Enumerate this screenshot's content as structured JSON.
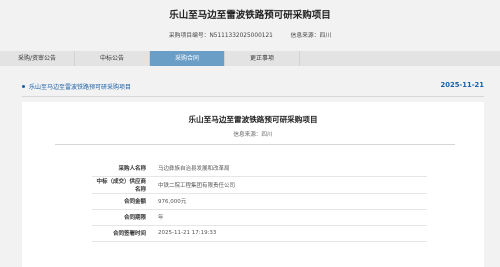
{
  "page": {
    "title": "乐山至马边至雷波铁路预可研采购项目"
  },
  "meta": {
    "project_no_label": "采购项目编号：",
    "project_no": "N5111332025000121",
    "source_label": "信息来源：",
    "source": "四川"
  },
  "tabs": [
    {
      "label": "采购/资审公告",
      "active": false
    },
    {
      "label": "中标公告",
      "active": false
    },
    {
      "label": "采购合同",
      "active": true
    },
    {
      "label": "更正事项",
      "active": false
    }
  ],
  "section": {
    "title": "乐山至马边至雷波铁路预可研采购项目",
    "date": "2025-11-21"
  },
  "document": {
    "title": "乐山至马边至雷波铁路预可研采购项目",
    "info_source": "信息来源：四川",
    "rows": [
      {
        "key": "采购人名称",
        "value": "马边彝族自治县发展和改革局"
      },
      {
        "key": "中标（成交）供应商名称",
        "value": "中铁二院工程集团有限责任公司"
      },
      {
        "key": "合同金额",
        "value": "976,000元"
      },
      {
        "key": "合同期限",
        "value": "年"
      },
      {
        "key": "合同签署时间",
        "value": "2025-11-21 17:19:33"
      }
    ]
  },
  "colors": {
    "accent": "#1a5fa8",
    "tab_active": "#6b9ec7",
    "background": "#f2f2f2"
  }
}
